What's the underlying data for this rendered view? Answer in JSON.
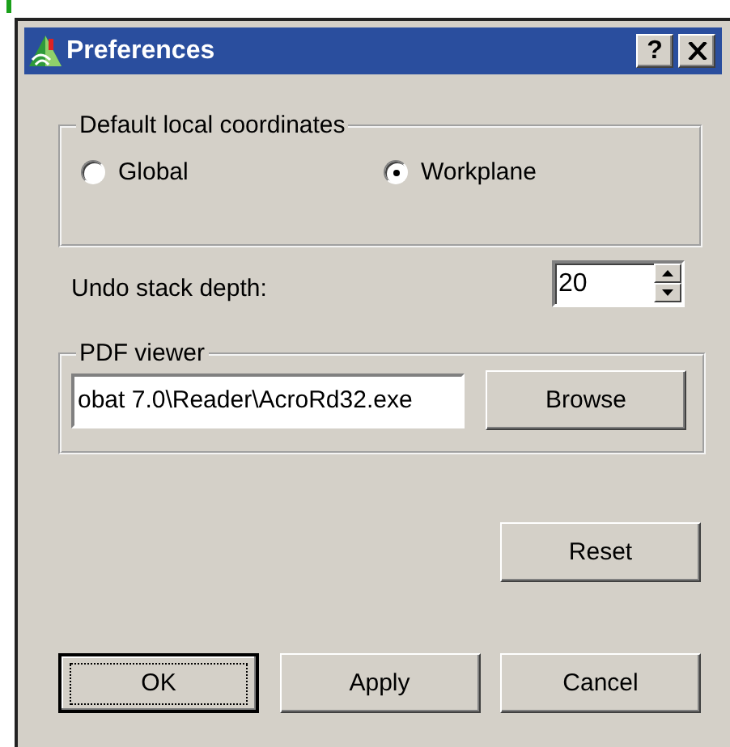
{
  "window": {
    "title": "Preferences",
    "help_button": "?"
  },
  "coordinates": {
    "label": "Default local coordinates",
    "options": [
      {
        "label": "Global",
        "selected": false
      },
      {
        "label": "Workplane",
        "selected": true
      }
    ]
  },
  "undo": {
    "label": "Undo stack depth:",
    "value": "20"
  },
  "pdf_viewer": {
    "label": "PDF viewer",
    "path": "obat 7.0\\Reader\\AcroRd32.exe",
    "button": "Browse"
  },
  "reset_button": "Reset",
  "buttons": [
    {
      "label": "OK",
      "default": true
    },
    {
      "label": "Apply",
      "default": false
    },
    {
      "label": "Cancel",
      "default": false
    }
  ]
}
